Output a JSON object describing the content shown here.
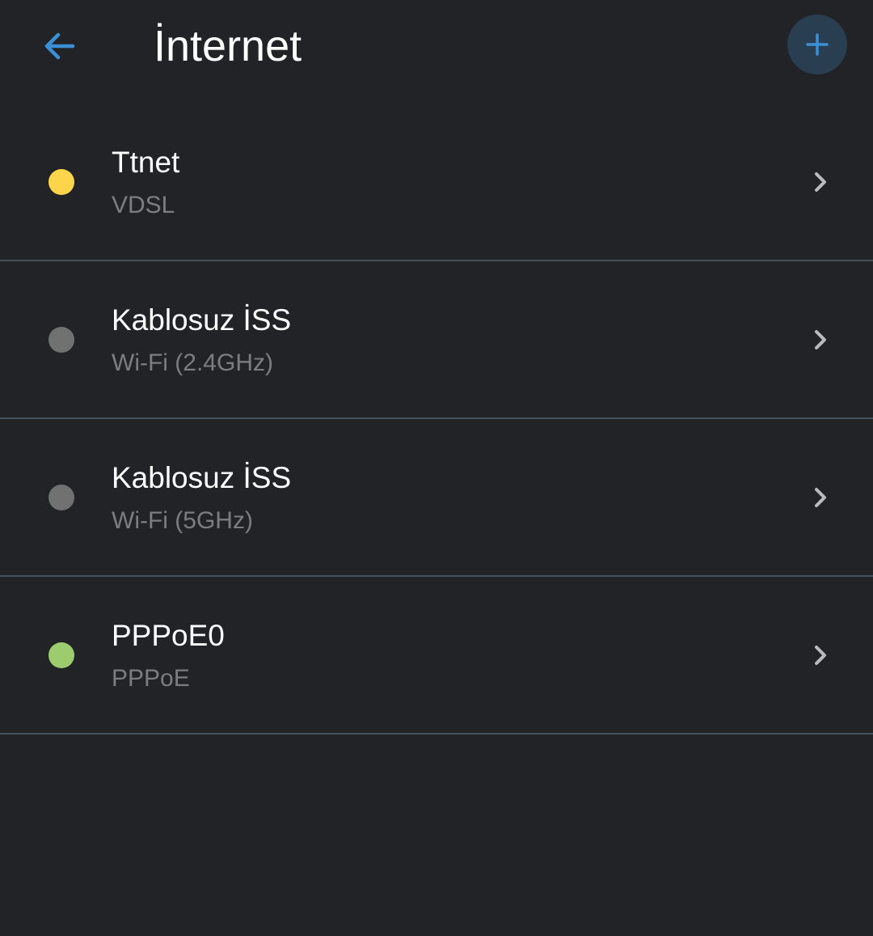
{
  "header": {
    "title": "İnternet",
    "back_icon": "arrow-left-icon",
    "add_icon": "plus-icon",
    "accent_color": "#3a8fd6",
    "add_button_bg": "#2a3e52"
  },
  "connections": [
    {
      "name": "Ttnet",
      "type": "VDSL",
      "status_color": "#fdd54a"
    },
    {
      "name": "Kablosuz İSS",
      "type": "Wi-Fi (2.4GHz)",
      "status_color": "#717171"
    },
    {
      "name": "Kablosuz İSS",
      "type": "Wi-Fi (5GHz)",
      "status_color": "#717171"
    },
    {
      "name": "PPPoE0",
      "type": "PPPoE",
      "status_color": "#9ccc6e"
    }
  ],
  "colors": {
    "background": "#222327",
    "divider": "#46505a",
    "title_text": "#ffffff",
    "subtitle_text": "#7b7d80",
    "chevron": "#b9bbbe"
  }
}
